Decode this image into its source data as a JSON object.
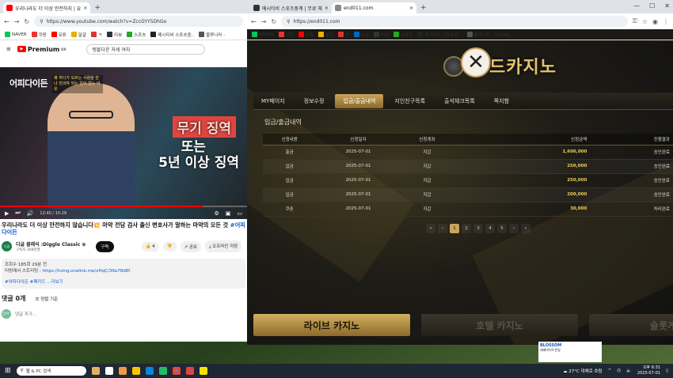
{
  "left_browser": {
    "tabs": [
      {
        "label": "우리나라도 더 이상 안전하지 | 유",
        "fav_color": "#ff0000"
      },
      {
        "label": "",
        "fav_color": ""
      }
    ],
    "url": "https://www.youtube.com/watch?v=ZccGYY5DhGo",
    "bookmarks": [
      "NAVER",
      "쿠팡",
      "유튜",
      "달걀",
      "ㅋ",
      "뉴스",
      "리뷰",
      "스포츠",
      "메시티비 스포츠중..",
      "블루나라 -"
    ]
  },
  "right_browser": {
    "tabs": [
      {
        "label": "메시티비 스포츠중계 | 무료 해",
        "fav_color": "#333333"
      },
      {
        "label": "end011.com",
        "fav_color": "#888888"
      }
    ],
    "url": "https://end011.com",
    "bookmarks": [
      "NAVER",
      "쿠팡",
      "유튜",
      "달걀",
      "ㅋ",
      "뉴스",
      "리뷰",
      "스포츠",
      "메시티비 스포츠중...",
      "블루나라 - 2024년..."
    ]
  },
  "youtube": {
    "logo": "Premium",
    "logo_sup": "KR",
    "search": "탱볼다운 자세 여자",
    "video": {
      "brand": "어피다이든",
      "overlay_text": "왜 하다가 모르는 사람을 만나 전과자 되는 일이 없는 이유",
      "caption_1": "무기 징역",
      "caption_2": "또는",
      "caption_3": "5년 이상 징역",
      "time": "12:40 / 15:29",
      "progress": 0.82
    },
    "title_text": "우리나라도 더 이상 안전하지 않습니다💥 마약 전담 검사 출신 변호사가 말하는 마약의 모든 것",
    "title_hash": "#어피다이든",
    "channel_avatar": "디글",
    "channel": "디글 클래식 :Diggle Classic ⊕",
    "subscribers": "구독자 308만명",
    "subscribe": "구독",
    "likes": "4",
    "share": "공유",
    "offline": "오프라인 저장",
    "desc_stats": "조회수 185회 29분 전",
    "desc_line": "티빙에서 스트리밍 : https://tving.onelink.me/xHqC/39a78d8f",
    "desc_link": "https://tving.onelink.me/xHqC/39a78d8f",
    "desc_tags": "#어피다이든 #패키드 ...더보기",
    "comments": "댓글 0개",
    "sort": "정렬 기준",
    "add_comment": "댓글 추가...",
    "commenter_avatar": "민우"
  },
  "casino": {
    "logo": "드카지노",
    "nav": [
      "MY페이지",
      "정보수정",
      "입금/출금내역",
      "지인친구목록",
      "출석체크목록",
      "쪽지함"
    ],
    "nav_active": 2,
    "page_title": "입금/출금내역",
    "columns": [
      "신청내용",
      "신청일자",
      "신청계좌",
      "신청금액",
      "진행결과"
    ],
    "rows": [
      [
        "출금",
        "2025-07-01",
        "지갑",
        "1,600,000",
        "승인완료"
      ],
      [
        "입금",
        "2025-07-01",
        "지갑",
        "250,000",
        "승인완료"
      ],
      [
        "입금",
        "2025-07-01",
        "지갑",
        "250,000",
        "승인완료"
      ],
      [
        "입금",
        "2025-07-01",
        "지갑",
        "200,000",
        "승인완료"
      ],
      [
        "쿠폰",
        "2025-07-01",
        "지갑",
        "30,000",
        "처리완료"
      ]
    ],
    "pager": [
      "«",
      "‹",
      "1",
      "2",
      "3",
      "4",
      "5",
      "›",
      "»"
    ],
    "pager_active": 2,
    "buttons": [
      "라이브 카지노",
      "호텔 카지노",
      "슬롯게임"
    ]
  },
  "adcard": {
    "title": "BLOSSOM",
    "text": "제베바이트판빛"
  },
  "taskbar": {
    "search": "웹 & PC 검색",
    "weather": "27°C 대체로 흐림",
    "time": "오후 6:31",
    "date": "2025-07-01"
  }
}
